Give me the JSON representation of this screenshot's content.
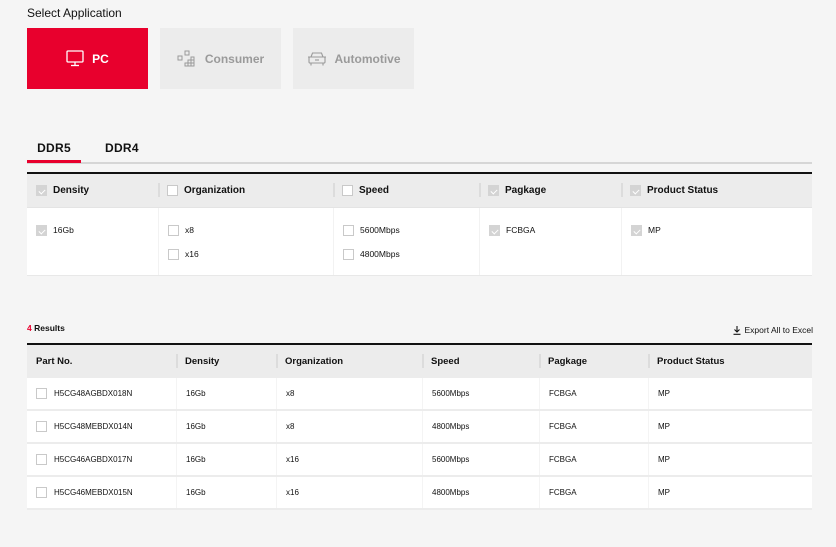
{
  "header": {
    "select_label": "Select Application"
  },
  "applications": [
    {
      "label": "PC",
      "icon": "monitor-icon",
      "active": true
    },
    {
      "label": "Consumer",
      "icon": "consumer-blocks-icon",
      "active": false
    },
    {
      "label": "Automotive",
      "icon": "car-icon",
      "active": false
    }
  ],
  "tabs": [
    {
      "label": "DDR5",
      "active": true
    },
    {
      "label": "DDR4",
      "active": false
    }
  ],
  "filters": {
    "columns": [
      {
        "label": "Density",
        "checked": true,
        "options": [
          {
            "label": "16Gb",
            "checked": true
          }
        ]
      },
      {
        "label": "Organization",
        "checked": false,
        "options": [
          {
            "label": "x8",
            "checked": false
          },
          {
            "label": "x16",
            "checked": false
          }
        ]
      },
      {
        "label": "Speed",
        "checked": false,
        "options": [
          {
            "label": "5600Mbps",
            "checked": false
          },
          {
            "label": "4800Mbps",
            "checked": false
          }
        ]
      },
      {
        "label": "Pagkage",
        "checked": true,
        "options": [
          {
            "label": "FCBGA",
            "checked": true
          }
        ]
      },
      {
        "label": "Product Status",
        "checked": true,
        "options": [
          {
            "label": "MP",
            "checked": true
          }
        ]
      }
    ]
  },
  "results": {
    "count": "4",
    "count_suffix": " Results",
    "export_label": "Export All to Excel",
    "columns": [
      "Part No.",
      "Density",
      "Organization",
      "Speed",
      "Pagkage",
      "Product Status"
    ],
    "rows": [
      [
        "H5CG48AGBDX018N",
        "16Gb",
        "x8",
        "5600Mbps",
        "FCBGA",
        "MP"
      ],
      [
        "H5CG48MEBDX014N",
        "16Gb",
        "x8",
        "4800Mbps",
        "FCBGA",
        "MP"
      ],
      [
        "H5CG46AGBDX017N",
        "16Gb",
        "x16",
        "5600Mbps",
        "FCBGA",
        "MP"
      ],
      [
        "H5CG46MEBDX015N",
        "16Gb",
        "x16",
        "4800Mbps",
        "FCBGA",
        "MP"
      ]
    ]
  },
  "colors": {
    "accent": "#e8002d",
    "inactive_bg": "#ececec",
    "page_bg": "#f5f5f5"
  }
}
